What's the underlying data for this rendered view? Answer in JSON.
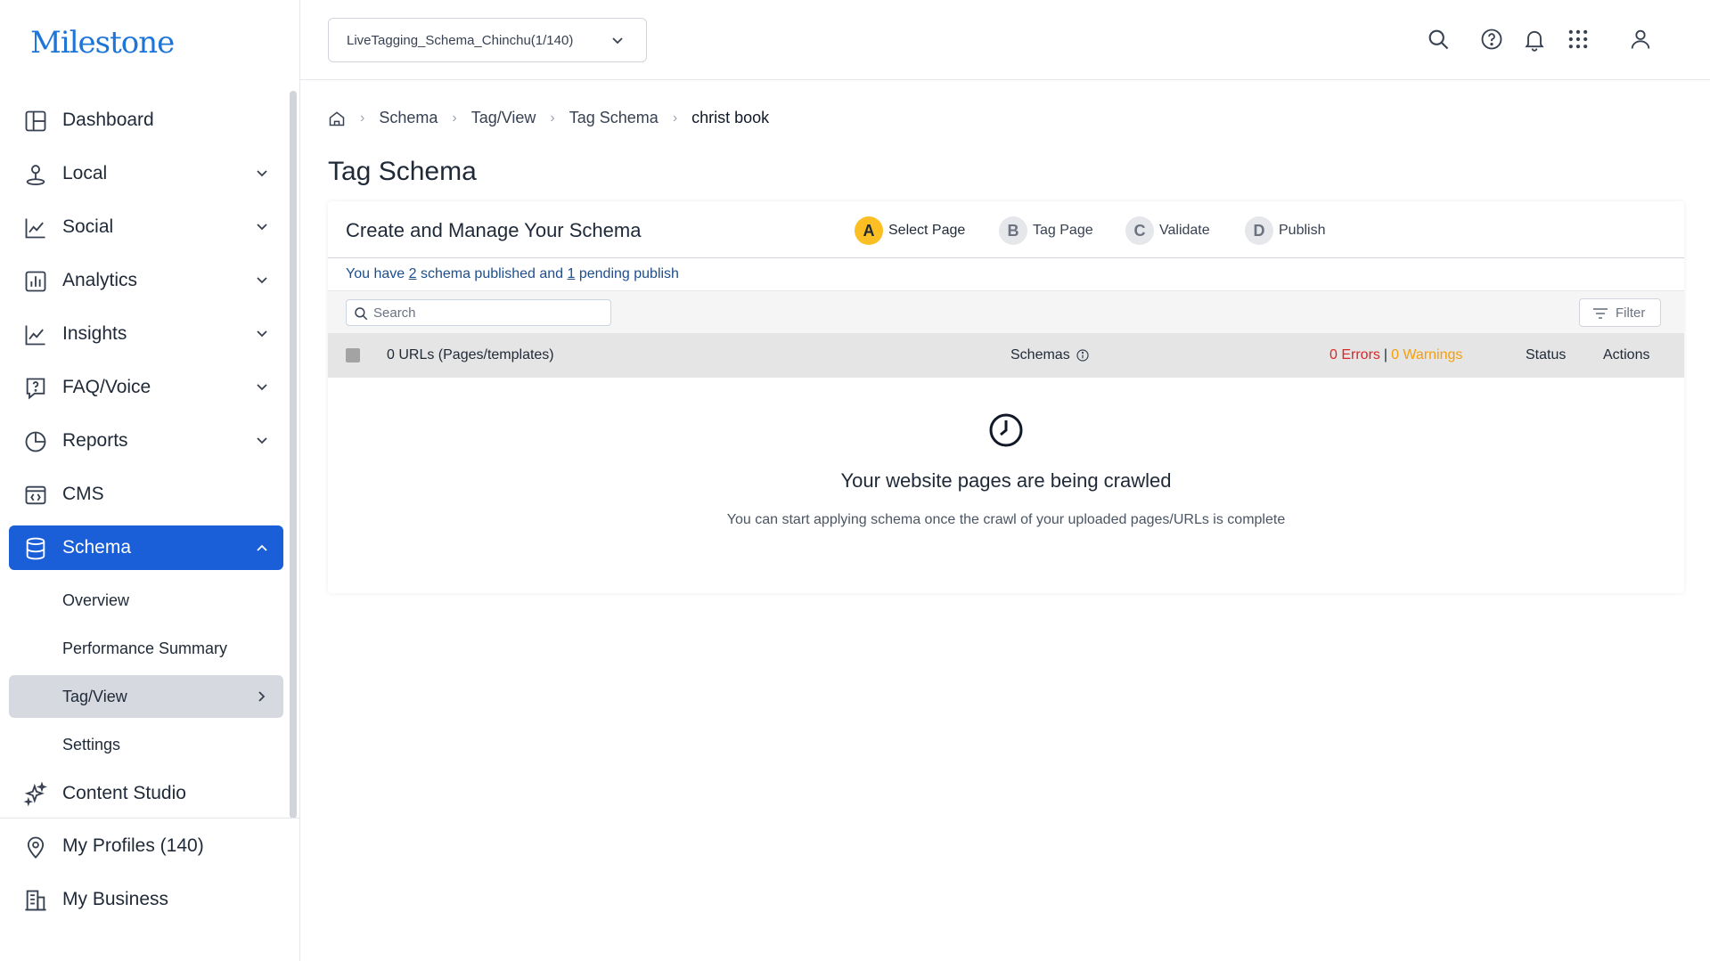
{
  "brand": {
    "logo_text": "Milestone",
    "accent": "#1a5fd8"
  },
  "sidebar": {
    "items": [
      {
        "label": "Dashboard",
        "icon": "dashboard-icon"
      },
      {
        "label": "Local",
        "icon": "location-pin-icon"
      },
      {
        "label": "Social",
        "icon": "chart-line-icon"
      },
      {
        "label": "Analytics",
        "icon": "bar-chart-icon"
      },
      {
        "label": "Insights",
        "icon": "chart-line-icon"
      },
      {
        "label": "FAQ/Voice",
        "icon": "question-chat-icon"
      },
      {
        "label": "Reports",
        "icon": "pie-chart-icon"
      },
      {
        "label": "CMS",
        "icon": "code-window-icon"
      },
      {
        "label": "Schema",
        "icon": "database-icon"
      }
    ],
    "schema_sub": [
      {
        "label": "Overview"
      },
      {
        "label": "Performance Summary"
      },
      {
        "label": "Tag/View"
      },
      {
        "label": "Settings"
      }
    ],
    "content_studio": "Content Studio",
    "bottom": [
      {
        "label": "My Profiles (140)"
      },
      {
        "label": "My Business"
      }
    ]
  },
  "header": {
    "profile_select": "LiveTagging_Schema_Chinchu(1/140)",
    "icons": [
      "search-icon",
      "help-icon",
      "bell-icon",
      "apps-grid-icon",
      "user-icon"
    ]
  },
  "breadcrumb": [
    "Schema",
    "Tag/View",
    "Tag Schema",
    "christ book"
  ],
  "page_title": "Tag Schema",
  "card": {
    "title": "Create and Manage Your Schema",
    "steps": [
      {
        "letter": "A",
        "label": "Select Page"
      },
      {
        "letter": "B",
        "label": "Tag Page"
      },
      {
        "letter": "C",
        "label": "Validate"
      },
      {
        "letter": "D",
        "label": "Publish"
      }
    ],
    "publish_line": {
      "prefix": "You have ",
      "published": "2",
      "mid": " schema published and ",
      "pending": "1",
      "suffix": " pending publish"
    },
    "search_placeholder": "Search",
    "filter_label": "Filter",
    "table_headers": {
      "urls": "0 URLs (Pages/templates)",
      "schemas": "Schemas",
      "errors": "0 Errors",
      "separator": "|",
      "warnings": "0 Warnings",
      "status": "Status",
      "actions": "Actions"
    },
    "empty_state": {
      "title": "Your website pages are being crawled",
      "subtitle": "You can start applying schema once the crawl of your uploaded pages/URLs is complete"
    }
  },
  "colors": {
    "error": "#dc2626",
    "warning": "#f59e0b",
    "active_step": "#fbbf24"
  }
}
